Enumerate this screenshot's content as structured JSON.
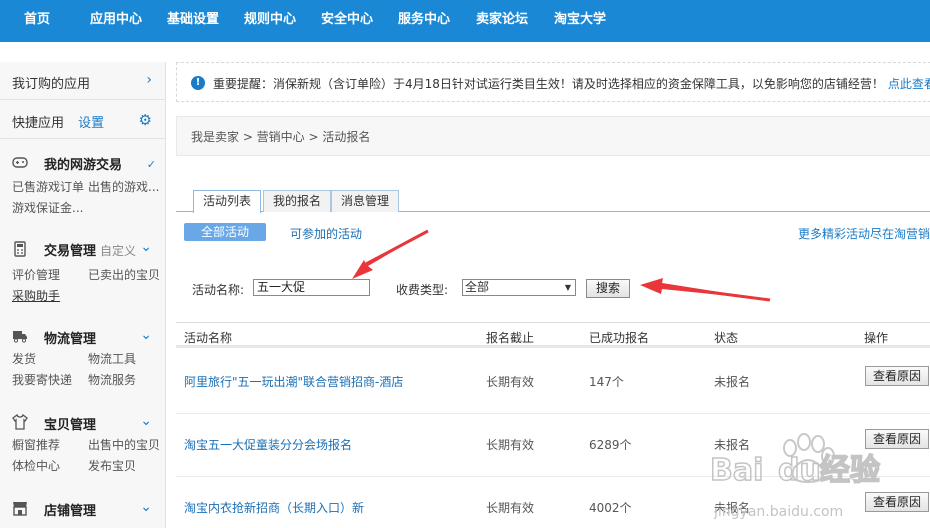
{
  "topnav": {
    "items": [
      "首页",
      "应用中心",
      "基础设置",
      "规则中心",
      "安全中心",
      "服务中心",
      "卖家论坛",
      "淘宝大学"
    ]
  },
  "sidebar": {
    "subscribed_label": "我订购的应用",
    "quick_label": "快捷应用",
    "quick_setting": "设置",
    "groups": [
      {
        "title": "我的网游交易",
        "extra": "",
        "subs": [
          "已售游戏订单",
          "出售的游戏...",
          "游戏保证金..."
        ]
      },
      {
        "title": "交易管理",
        "extra": "自定义",
        "subs": [
          "评价管理",
          "已卖出的宝贝",
          "采购助手"
        ]
      },
      {
        "title": "物流管理",
        "extra": "",
        "subs": [
          "发货",
          "物流工具",
          "我要寄快递",
          "物流服务"
        ]
      },
      {
        "title": "宝贝管理",
        "extra": "",
        "subs": [
          "橱窗推荐",
          "出售中的宝贝",
          "体检中心",
          "发布宝贝"
        ]
      },
      {
        "title": "店铺管理",
        "extra": "",
        "subs": []
      }
    ]
  },
  "notice": {
    "icon": "!",
    "text": "重要提醒：消保新规（含订单险）于4月18日针对试运行类目生效！请及时选择相应的资金保障工具，以免影响您的店铺经营！",
    "link": "点此查看"
  },
  "breadcrumb": "我是卖家 > 营销中心 > 活动报名",
  "tabs": [
    "活动列表",
    "我的报名",
    "消息管理"
  ],
  "filters": {
    "all_label": "全部活动",
    "joinable_label": "可参加的活动",
    "more_label": "更多精彩活动尽在淘营销"
  },
  "search": {
    "name_label": "活动名称:",
    "name_value": "五一大促",
    "fee_label": "收费类型:",
    "fee_value": "全部",
    "button": "搜索"
  },
  "table": {
    "headers": [
      "活动名称",
      "报名截止",
      "已成功报名",
      "状态",
      "操作"
    ],
    "rows": [
      {
        "name": "阿里旅行\"五一玩出潮\"联合营销招商-酒店",
        "deadline": "长期有效",
        "count": "147个",
        "status": "未报名",
        "action": "查看原因"
      },
      {
        "name": "淘宝五一大促童装分分会场报名",
        "deadline": "长期有效",
        "count": "6289个",
        "status": "未报名",
        "action": "查看原因"
      },
      {
        "name": "淘宝内衣抢新招商（长期入口）新",
        "deadline": "长期有效",
        "count": "4002个",
        "status": "未报名",
        "action": "查看原因"
      }
    ]
  },
  "watermark": {
    "brand": "Bai",
    "brand2": "du",
    "cn": "经验",
    "url": "jingyan.baidu.com"
  },
  "colors": {
    "nav_bg": "#1a88d4",
    "link": "#1a6fb5",
    "arrow": "#e8363b"
  }
}
